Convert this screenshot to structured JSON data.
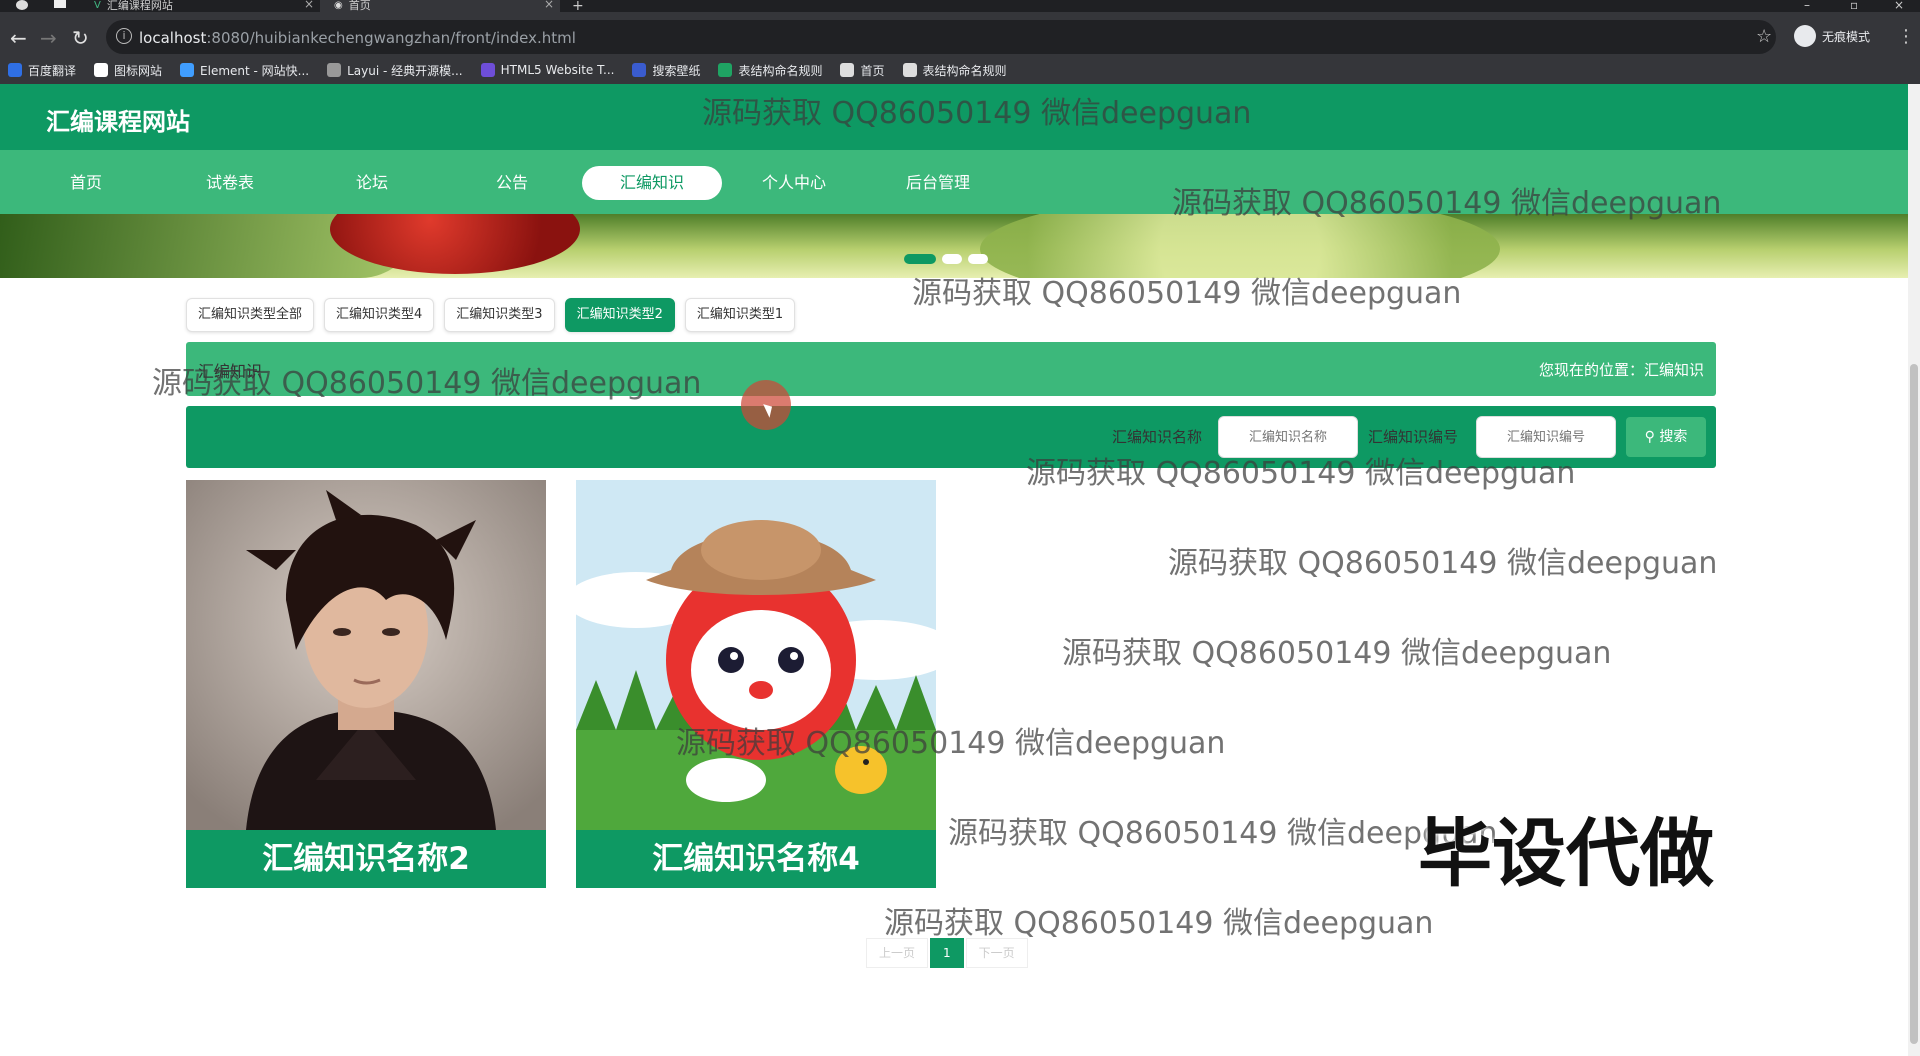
{
  "browser": {
    "tabs": [
      {
        "title": "汇编课程网站",
        "active": false
      },
      {
        "title": "首页",
        "active": true
      }
    ],
    "url_host": "localhost",
    "url_path": ":8080/huibiankechengwangzhan/front/index.html",
    "incognito_label": "无痕模式",
    "bookmarks": [
      {
        "label": "百度翻译",
        "color": "#2f6fe4"
      },
      {
        "label": "图标网站",
        "color": "#ffffff"
      },
      {
        "label": "Element - 网站快...",
        "color": "#409eff"
      },
      {
        "label": "Layui - 经典开源模...",
        "color": "#999999"
      },
      {
        "label": "HTML5 Website T...",
        "color": "#6e4ed8"
      },
      {
        "label": "搜索壁纸",
        "color": "#3a5ccf"
      },
      {
        "label": "表结构命名规则",
        "color": "#1fa463"
      },
      {
        "label": "首页",
        "color": "#dddddd"
      },
      {
        "label": "表结构命名规则",
        "color": "#dddddd"
      }
    ]
  },
  "site": {
    "title": "汇编课程网站",
    "nav": [
      {
        "label": "首页",
        "active": false
      },
      {
        "label": "试卷表",
        "active": false
      },
      {
        "label": "论坛",
        "active": false
      },
      {
        "label": "公告",
        "active": false
      },
      {
        "label": "汇编知识",
        "active": true
      },
      {
        "label": "个人中心",
        "active": false
      },
      {
        "label": "后台管理",
        "active": false
      }
    ],
    "accent_color": "#0e9963",
    "light_accent_color": "#3cb87b"
  },
  "categories": [
    {
      "label": "汇编知识类型全部",
      "active": false
    },
    {
      "label": "汇编知识类型4",
      "active": false
    },
    {
      "label": "汇编知识类型3",
      "active": false
    },
    {
      "label": "汇编知识类型2",
      "active": true
    },
    {
      "label": "汇编知识类型1",
      "active": false
    }
  ],
  "breadcrumb": {
    "title": "汇编知识",
    "location": "您现在的位置：汇编知识"
  },
  "search": {
    "name_label": "汇编知识名称",
    "name_placeholder": "汇编知识名称",
    "code_label": "汇编知识编号",
    "code_placeholder": "汇编知识编号",
    "button_label": "搜索"
  },
  "cards": [
    {
      "caption": "汇编知识名称2"
    },
    {
      "caption": "汇编知识名称4"
    }
  ],
  "pagination": {
    "prev": "上一页",
    "current": "1",
    "next": "下一页"
  },
  "overlay": {
    "watermark": "源码获取 QQ86050149 微信deepguan",
    "promo": "毕设代做"
  }
}
